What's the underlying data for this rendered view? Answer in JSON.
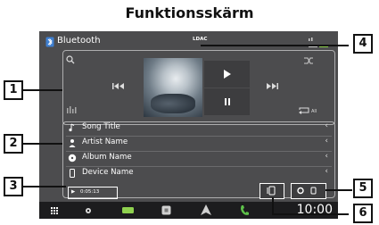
{
  "heading": "Funktionsskärm",
  "source": {
    "label": "Bluetooth",
    "icon": "bluetooth-source-icon"
  },
  "codec_badge": "LDAC",
  "status": {
    "icons": [
      "signal-icon",
      "battery-icon"
    ]
  },
  "playback": {
    "controls": [
      "search-icon",
      "previous-icon",
      "play-icon",
      "pause-icon",
      "next-icon",
      "shuffle-icon",
      "repeat-all-icon",
      "equalizer-icon"
    ],
    "repeat_label": "All"
  },
  "track_info": [
    {
      "label": "Song Title",
      "icon": "music-note-icon"
    },
    {
      "label": "Artist Name",
      "icon": "person-icon"
    },
    {
      "label": "Album Name",
      "icon": "disc-icon"
    },
    {
      "label": "Device Name",
      "icon": "phone-icon"
    }
  ],
  "play_time": "0:05:13",
  "bottom_bar": {
    "icons": [
      "grid-menu-icon",
      "settings-icon",
      "battery-icon",
      "square-icon",
      "navigation-icon",
      "phone-icon"
    ],
    "clock": "10:00"
  },
  "callouts": [
    "1",
    "2",
    "3",
    "4",
    "5",
    "6"
  ]
}
